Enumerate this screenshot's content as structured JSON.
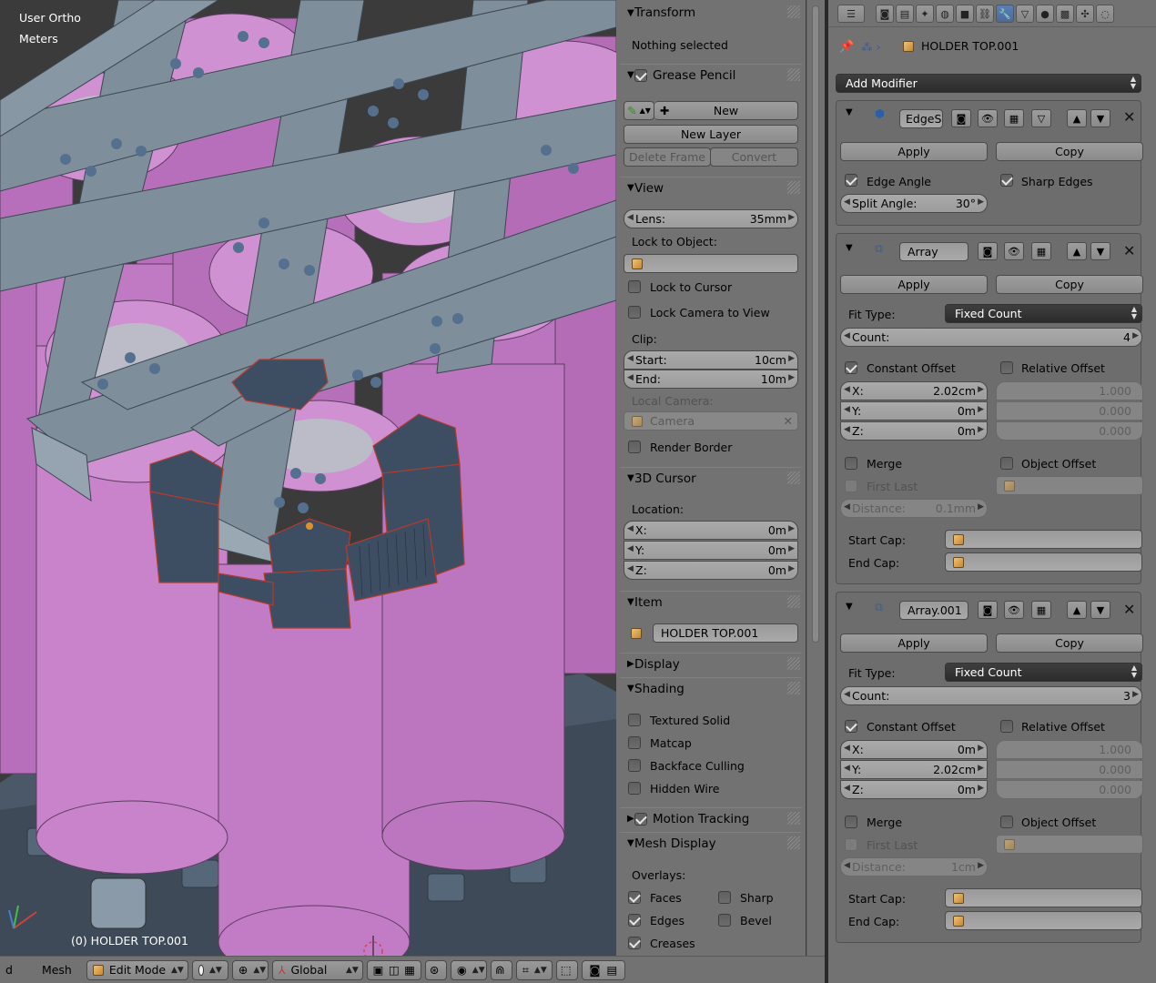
{
  "viewport": {
    "view_label": "User Ortho",
    "units_label": "Meters",
    "object_label": "(0) HOLDER TOP.001"
  },
  "header": {
    "menu_left": "d",
    "mesh_menu": "Mesh",
    "mode": "Edit Mode",
    "orientation": "Global"
  },
  "npanel": {
    "transform": {
      "title": "Transform",
      "status": "Nothing selected"
    },
    "grease_pencil": {
      "title": "Grease Pencil",
      "new_label": "New",
      "new_layer_label": "New Layer",
      "delete_frame_label": "Delete Frame",
      "convert_label": "Convert"
    },
    "view": {
      "title": "View",
      "lens_label": "Lens:",
      "lens_value": "35mm",
      "lock_to_object_label": "Lock to Object:",
      "lock_to_cursor_label": "Lock to Cursor",
      "lock_camera_label": "Lock Camera to View",
      "clip_label": "Clip:",
      "start_label": "Start:",
      "start_value": "10cm",
      "end_label": "End:",
      "end_value": "10m",
      "local_camera_label": "Local Camera:",
      "camera_value": "Camera",
      "render_border_label": "Render Border"
    },
    "cursor": {
      "title": "3D Cursor",
      "location_label": "Location:",
      "x_label": "X:",
      "x_value": "0m",
      "y_label": "Y:",
      "y_value": "0m",
      "z_label": "Z:",
      "z_value": "0m"
    },
    "item": {
      "title": "Item",
      "name": "HOLDER TOP.001"
    },
    "display": {
      "title": "Display"
    },
    "shading": {
      "title": "Shading",
      "textured_solid": "Textured Solid",
      "matcap": "Matcap",
      "backface_culling": "Backface Culling",
      "hidden_wire": "Hidden Wire"
    },
    "motion_tracking": {
      "title": "Motion Tracking"
    },
    "mesh_display": {
      "title": "Mesh Display",
      "overlays_label": "Overlays:",
      "faces": "Faces",
      "sharp": "Sharp",
      "edges": "Edges",
      "bevel": "Bevel",
      "creases": "Creases"
    }
  },
  "properties": {
    "object_name": "HOLDER TOP.001",
    "add_modifier_label": "Add Modifier",
    "modifiers": [
      {
        "name": "EdgeS",
        "apply_label": "Apply",
        "copy_label": "Copy",
        "edge_angle_label": "Edge Angle",
        "sharp_edges_label": "Sharp Edges",
        "split_angle_label": "Split Angle:",
        "split_angle_value": "30°"
      },
      {
        "name": "Array",
        "apply_label": "Apply",
        "copy_label": "Copy",
        "fit_type_label": "Fit Type:",
        "fit_type_value": "Fixed Count",
        "count_label": "Count:",
        "count_value": "4",
        "constant_offset_label": "Constant Offset",
        "relative_offset_label": "Relative Offset",
        "x_label": "X:",
        "x_value": "2.02cm",
        "y_label": "Y:",
        "y_value": "0m",
        "z_label": "Z:",
        "z_value": "0m",
        "rel_x": "1.000",
        "rel_y": "0.000",
        "rel_z": "0.000",
        "merge_label": "Merge",
        "object_offset_label": "Object Offset",
        "first_last_label": "First Last",
        "distance_label": "Distance:",
        "distance_value": "0.1mm",
        "start_cap_label": "Start Cap:",
        "end_cap_label": "End Cap:"
      },
      {
        "name": "Array.001",
        "apply_label": "Apply",
        "copy_label": "Copy",
        "fit_type_label": "Fit Type:",
        "fit_type_value": "Fixed Count",
        "count_label": "Count:",
        "count_value": "3",
        "constant_offset_label": "Constant Offset",
        "relative_offset_label": "Relative Offset",
        "x_label": "X:",
        "x_value": "0m",
        "y_label": "Y:",
        "y_value": "2.02cm",
        "z_label": "Z:",
        "z_value": "0m",
        "rel_x": "1.000",
        "rel_y": "0.000",
        "rel_z": "0.000",
        "merge_label": "Merge",
        "object_offset_label": "Object Offset",
        "first_last_label": "First Last",
        "distance_label": "Distance:",
        "distance_value": "1cm",
        "start_cap_label": "Start Cap:",
        "end_cap_label": "End Cap:"
      }
    ]
  },
  "colors": {
    "cell_pink": "#c67dc8",
    "holder_grey": "#7e8e9a",
    "mesh_blue": "#3e4f63",
    "panel_bg": "#727272",
    "active_tab": "#5b7fb5"
  }
}
